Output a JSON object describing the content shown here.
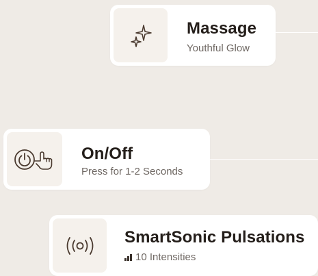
{
  "cards": [
    {
      "id": "massage",
      "title": "Massage",
      "subtitle": "Youthful Glow",
      "icon": "sparkle-icon"
    },
    {
      "id": "on-off",
      "title": "On/Off",
      "subtitle": "Press for 1-2 Seconds",
      "icon": "power-press-icon"
    },
    {
      "id": "smartsonic",
      "title": "SmartSonic Pulsations",
      "subtitle": "10 Intensities",
      "icon": "sonic-wave-icon",
      "subtitle_icon": "signal-bars-icon"
    }
  ],
  "colors": {
    "background": "#efebe6",
    "card": "#ffffff",
    "icon_tile": "#f5f1ec",
    "title": "#241e1a",
    "subtitle": "#6f6863",
    "icon_stroke": "#4a3a2f"
  }
}
